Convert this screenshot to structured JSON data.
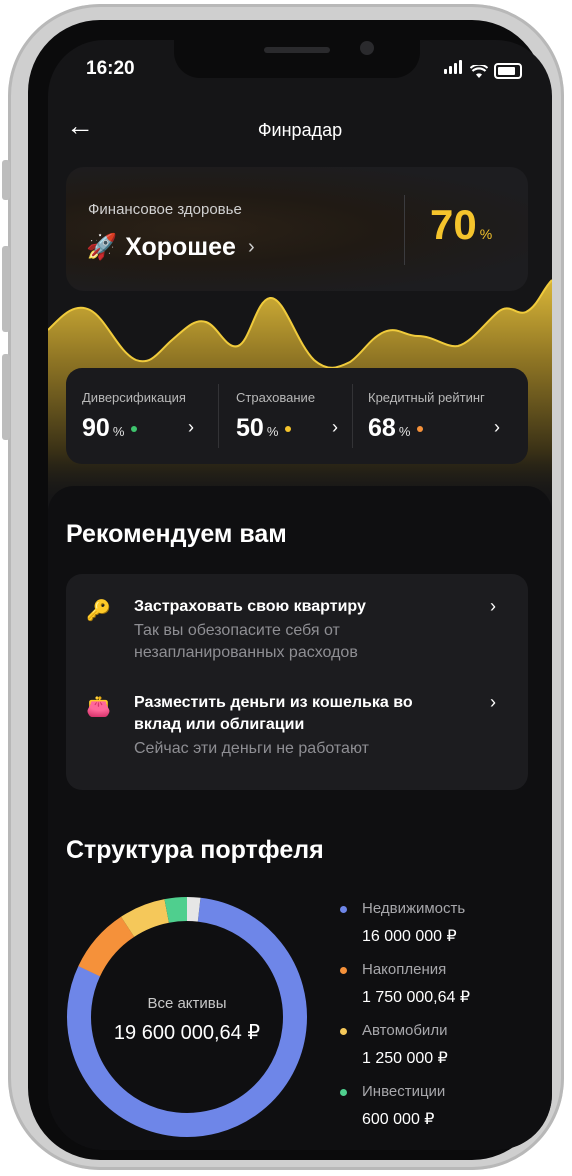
{
  "status_bar": {
    "time": "16:20"
  },
  "header": {
    "title": "Финрадар",
    "back_icon": "←"
  },
  "health": {
    "label": "Финансовое здоровье",
    "emoji": "🚀",
    "state": "Хорошее",
    "chevron": "›",
    "percent": "70",
    "percent_unit": "%",
    "accent": "#f5c42c"
  },
  "metrics": [
    {
      "label": "Диверсификация",
      "value": "90",
      "unit": "%",
      "dot_color": "#3ec46d",
      "chevron": "›"
    },
    {
      "label": "Страхование",
      "value": "50",
      "unit": "%",
      "dot_color": "#f5c42c",
      "chevron": "›"
    },
    {
      "label": "Кредитный рейтинг",
      "value": "68",
      "unit": "%",
      "dot_color": "#f5913a",
      "chevron": "›"
    }
  ],
  "recommendations": {
    "title": "Рекомендуем вам",
    "items": [
      {
        "icon": "🔑",
        "title": "Застраховать свою квартиру",
        "subtitle": "Так вы обезопасите себя от незапланированных расходов",
        "chevron": "›"
      },
      {
        "icon": "👛",
        "title": "Разместить деньги из кошелька во вклад или облигации",
        "subtitle": "Сейчас эти деньги не работают",
        "chevron": "›"
      }
    ]
  },
  "portfolio": {
    "title": "Структура портфеля",
    "center_label": "Все активы",
    "center_total": "19 600 000,64 ₽",
    "legend": [
      {
        "name": "Недвижимость",
        "value": "16 000 000 ₽",
        "color": "#6e86e8"
      },
      {
        "name": "Накопления",
        "value": "1 750 000,64 ₽",
        "color": "#f5913a"
      },
      {
        "name": "Автомобили",
        "value": "1 250 000 ₽",
        "color": "#f5c85a"
      },
      {
        "name": "Инвестиции",
        "value": "600 000 ₽",
        "color": "#4fcf8e"
      }
    ]
  },
  "chart_data": {
    "type": "pie",
    "categories": [
      "Недвижимость",
      "Накопления",
      "Автомобили",
      "Инвестиции",
      ""
    ],
    "values": [
      16000000,
      1750000.64,
      1250000,
      600000,
      0
    ],
    "colors": [
      "#6e86e8",
      "#f5913a",
      "#f5c85a",
      "#4fcf8e",
      "#e6e6e6"
    ],
    "title": "Структура портфеля",
    "total": "19 600 000,64 ₽"
  }
}
